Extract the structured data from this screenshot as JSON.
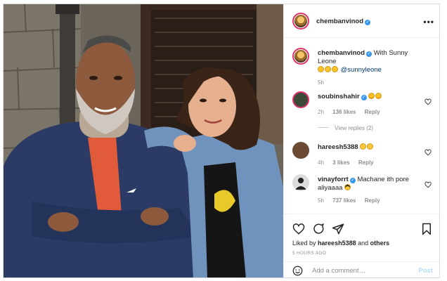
{
  "post": {
    "author": "chembanvinod",
    "caption_text": "With Sunny Leone",
    "caption_mention": "@sunnyleone",
    "caption_time": "5h",
    "more_label": "•••"
  },
  "comments": [
    {
      "user": "soubinshahir",
      "verified": true,
      "text": "",
      "emojis": [
        "heart-eyes-emoji",
        "heart-eyes-emoji"
      ],
      "time": "2h",
      "likes": "136 likes",
      "reply": "Reply",
      "view_replies": "View replies (2)"
    },
    {
      "user": "hareesh5388",
      "verified": false,
      "text": "",
      "emojis": [
        "surprised-emoji",
        "surprised-emoji"
      ],
      "time": "4h",
      "likes": "3 likes",
      "reply": "Reply"
    },
    {
      "user": "vinayforrt",
      "verified": true,
      "text": "Machane ith pore aliyaaaa",
      "emojis": [
        "sunglasses-emoji"
      ],
      "time": "5h",
      "likes": "737 likes",
      "reply": "Reply"
    }
  ],
  "actions": {
    "liked_by_prefix": "Liked by",
    "liked_by_user": "hareesh5388",
    "liked_by_and": "and",
    "liked_by_others": "others",
    "time_ago": "5 HOURS AGO"
  },
  "add_comment": {
    "placeholder": "Add a comment…",
    "post_label": "Post"
  },
  "colors": {
    "verified": "#3897f0",
    "muted": "#8e8e8e",
    "post_disabled": "#b2dffc",
    "story_ring": "#e1306c"
  }
}
